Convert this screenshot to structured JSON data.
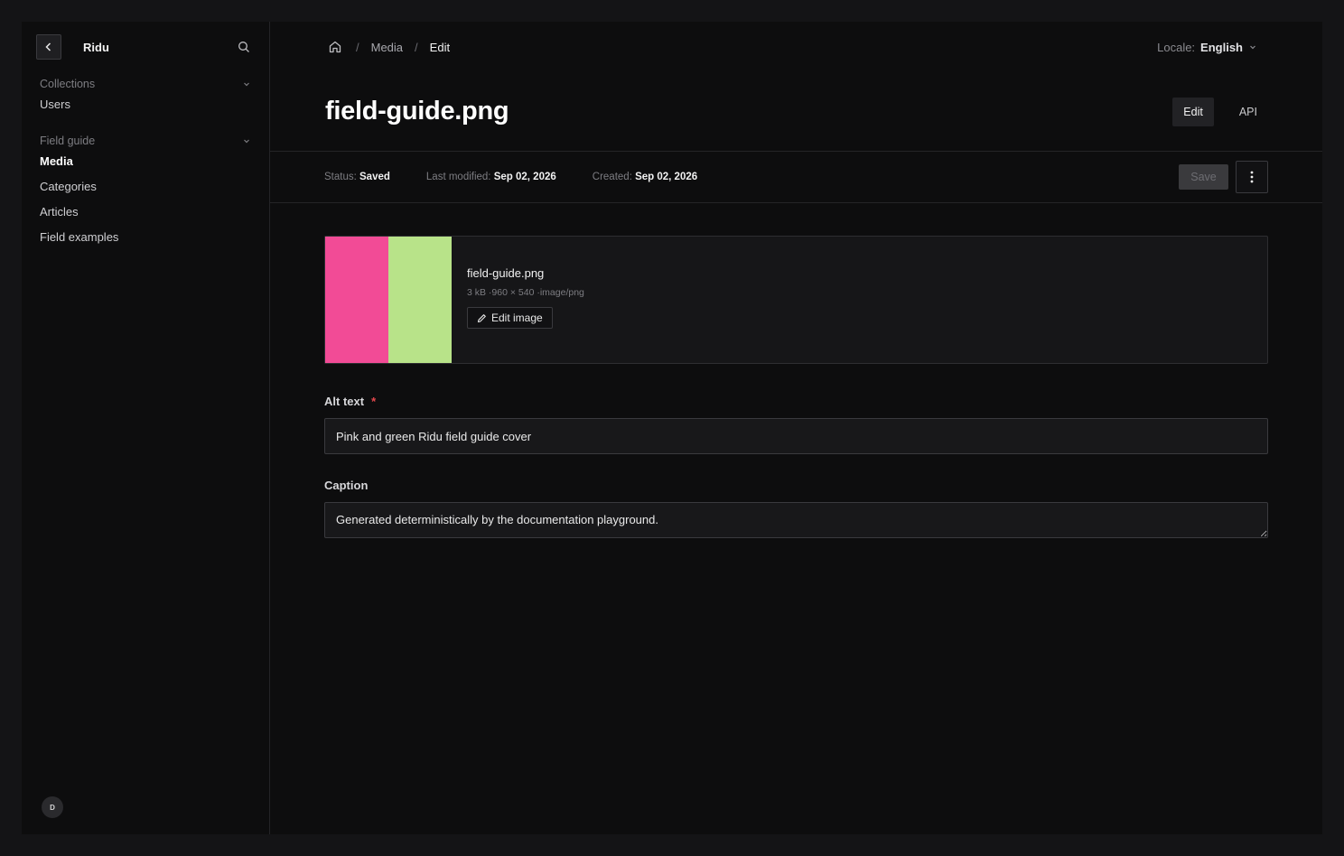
{
  "sidebar": {
    "brand": "Ridu",
    "groups": [
      {
        "label": "Collections",
        "items": [
          {
            "label": "Users"
          }
        ]
      },
      {
        "label": "Field guide",
        "items": [
          {
            "label": "Media"
          },
          {
            "label": "Categories"
          },
          {
            "label": "Articles"
          },
          {
            "label": "Field examples"
          }
        ]
      }
    ],
    "avatar_initial": "D"
  },
  "header": {
    "breadcrumbs": [
      "Media",
      "Edit"
    ],
    "locale_label": "Locale:",
    "locale_value": "English"
  },
  "document": {
    "title": "field-guide.png",
    "tabs": [
      "Edit",
      "API"
    ],
    "status_label": "Status:",
    "status_value": "Saved",
    "modified_label": "Last modified:",
    "modified_value": "Sep 02, 2026",
    "created_label": "Created:",
    "created_value": "Sep 02, 2026",
    "save_label": "Save"
  },
  "upload": {
    "filename": "field-guide.png",
    "meta": "3 kB ·960 × 540 ·image/png",
    "edit_label": "Edit image",
    "thumb_colors": [
      "#f24b96",
      "#b8e389"
    ]
  },
  "fields": {
    "alt_label": "Alt text",
    "alt_required": "*",
    "alt_value": "Pink and green Ridu field guide cover",
    "caption_label": "Caption",
    "caption_value": "Generated deterministically by the documentation playground."
  },
  "icons": [
    "chevron-left-icon",
    "search-icon",
    "chevron-down-icon",
    "home-icon",
    "more-vertical-icon",
    "pencil-icon"
  ]
}
